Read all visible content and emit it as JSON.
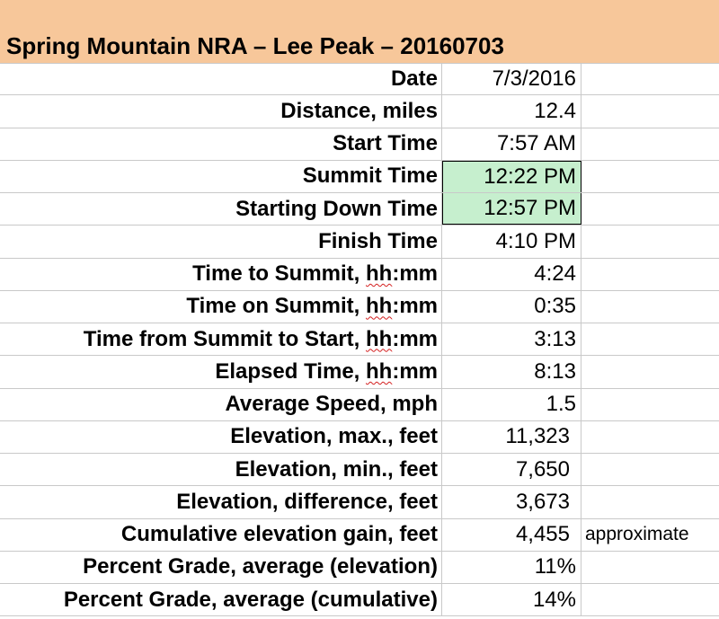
{
  "title": "Spring Mountain NRA – Lee Peak – 20160703",
  "rows": [
    {
      "label": "Date",
      "value": "7/3/2016"
    },
    {
      "label": "Distance, miles",
      "value": "12.4"
    },
    {
      "label": "Start Time",
      "value": "7:57 AM"
    },
    {
      "label": "Summit Time",
      "value": "12:22 PM",
      "highlight": true
    },
    {
      "label": "Starting Down Time",
      "value": "12:57 PM",
      "highlight": true
    },
    {
      "label": "Finish Time",
      "value": "4:10 PM"
    },
    {
      "label_prefix": "Time to Summit, ",
      "label_unit": "hh",
      "label_suffix": ":mm",
      "value": "4:24"
    },
    {
      "label_prefix": "Time on Summit, ",
      "label_unit": "hh",
      "label_suffix": ":mm",
      "value": "0:35"
    },
    {
      "label_prefix": "Time from Summit to Start, ",
      "label_unit": "hh",
      "label_suffix": ":mm",
      "value": "3:13"
    },
    {
      "label_prefix": "Elapsed Time, ",
      "label_unit": "hh",
      "label_suffix": ":mm",
      "value": "8:13"
    },
    {
      "label": "Average Speed, mph",
      "value": "1.5"
    },
    {
      "label": "Elevation, max., feet",
      "value": "11,323"
    },
    {
      "label": "Elevation, min., feet",
      "value": "7,650"
    },
    {
      "label": "Elevation, difference, feet",
      "value": "3,673"
    },
    {
      "label": "Cumulative elevation gain, feet",
      "value": "4,455",
      "note": "approximate"
    },
    {
      "label": "Percent Grade, average (elevation)",
      "value": "11%"
    },
    {
      "label": "Percent Grade, average (cumulative)",
      "value": "14%"
    }
  ],
  "colors": {
    "title_band": "#f7c79a",
    "highlight": "#c6efce",
    "gridline": "#c9c9c9",
    "spellcheck": "#d42020"
  }
}
